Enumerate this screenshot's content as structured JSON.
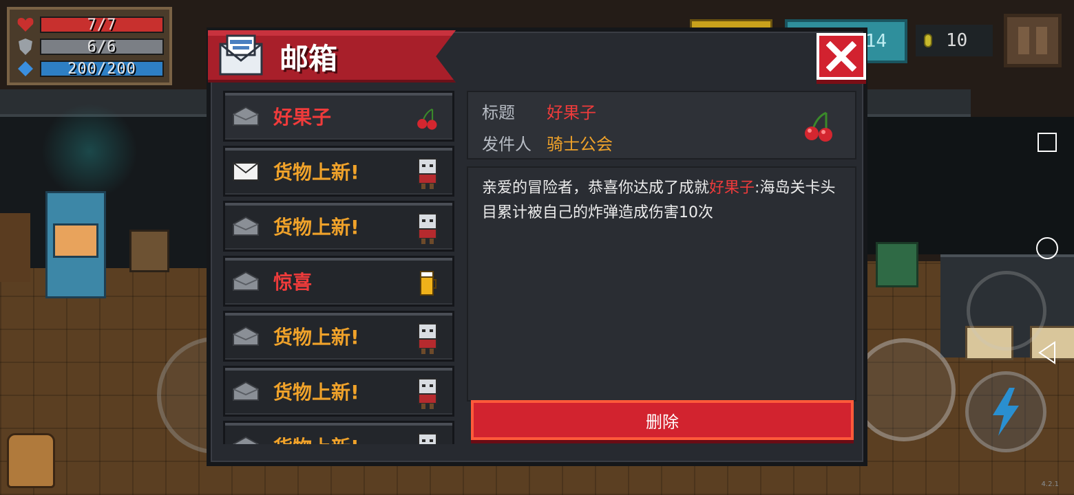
{
  "hud": {
    "hp": {
      "text": "7/7",
      "fill": 1.0,
      "color": "#c8302e"
    },
    "armor": {
      "text": "6/6",
      "fill": 1.0,
      "color": "#7b7f85"
    },
    "energy": {
      "text": "200/200",
      "fill": 1.0,
      "color": "#2e7fc4"
    },
    "teal_value": "14",
    "coins": "10"
  },
  "mailbox": {
    "title": "邮箱",
    "items": [
      {
        "label": "好果子",
        "color": "red",
        "icon": "cherry-icon",
        "opened": false
      },
      {
        "label": "货物上新!",
        "color": "orange",
        "icon": "merchant-icon",
        "opened": true
      },
      {
        "label": "货物上新!",
        "color": "orange",
        "icon": "merchant-icon",
        "opened": false
      },
      {
        "label": "惊喜",
        "color": "red",
        "icon": "beer-icon",
        "opened": false
      },
      {
        "label": "货物上新!",
        "color": "orange",
        "icon": "merchant-icon",
        "opened": false
      },
      {
        "label": "货物上新!",
        "color": "orange",
        "icon": "merchant-icon",
        "opened": false
      },
      {
        "label": "货物上新!",
        "color": "orange",
        "icon": "merchant-icon",
        "opened": false
      }
    ],
    "detail": {
      "title_key": "标题",
      "title_value": "好果子",
      "sender_key": "发件人",
      "sender_value": "骑士公会",
      "body_prefix": "亲爱的冒险者，恭喜你达成了成就",
      "body_highlight": "好果子",
      "body_suffix": ":海岛关卡头目累计被自己的炸弹造成伤害10次"
    },
    "delete_label": "删除"
  },
  "version": "4.2.1",
  "colors": {
    "accent_red": "#d2232f",
    "mail_red": "#ef3b3b",
    "mail_orange": "#f0a22a"
  }
}
